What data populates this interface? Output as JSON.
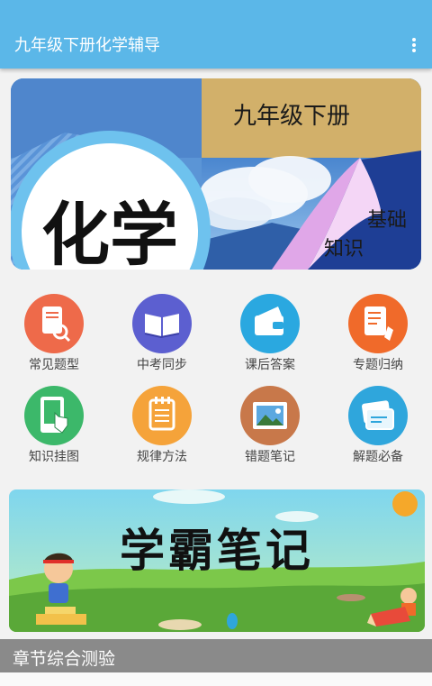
{
  "app": {
    "title": "九年级下册化学辅导"
  },
  "banner": {
    "grade_label": "九年级下册",
    "subject": "化学",
    "tagline_1": "基础",
    "tagline_2": "知识"
  },
  "menu": [
    {
      "label": "常见题型",
      "icon": "magnifier-document-icon",
      "color": "#ee6a4a"
    },
    {
      "label": "中考同步",
      "icon": "open-book-icon",
      "color": "#5c5fd0"
    },
    {
      "label": "课后答案",
      "icon": "wallet-icon",
      "color": "#2aa8e0"
    },
    {
      "label": "专题归纳",
      "icon": "pencil-note-icon",
      "color": "#f06a2a"
    },
    {
      "label": "知识挂图",
      "icon": "touch-hand-icon",
      "color": "#3cb86a"
    },
    {
      "label": "规律方法",
      "icon": "notepad-icon",
      "color": "#f5a33a"
    },
    {
      "label": "错题笔记",
      "icon": "picture-icon",
      "color": "#c8784a"
    },
    {
      "label": "解题必备",
      "icon": "cards-icon",
      "color": "#2fa6dc"
    }
  ],
  "promo": {
    "title": "学霸笔记"
  },
  "section": {
    "title": "章节综合测验"
  }
}
